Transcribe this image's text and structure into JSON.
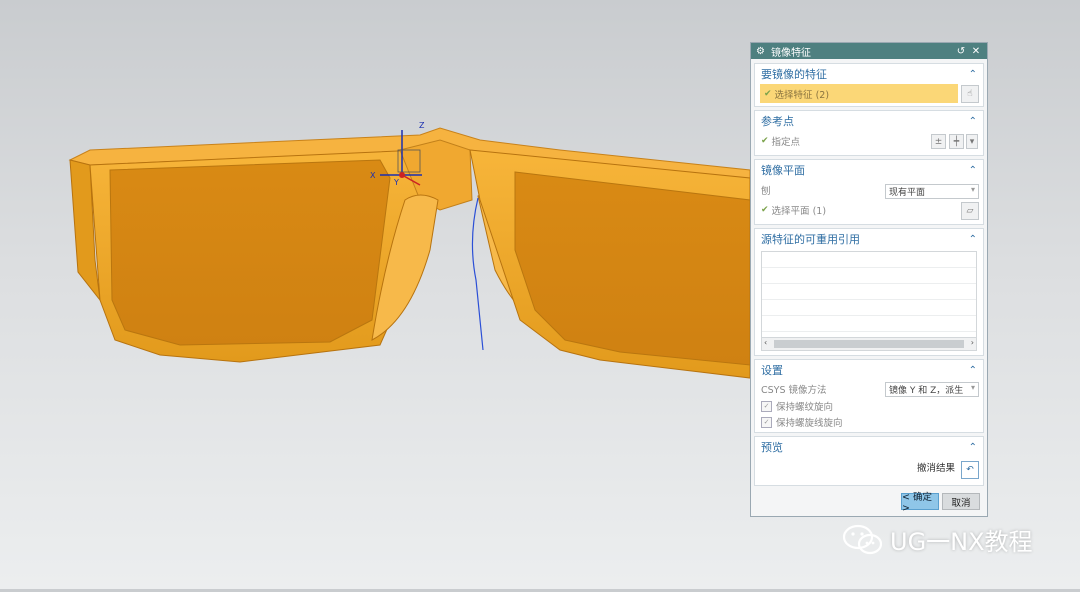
{
  "dialog": {
    "title": "镜像特征",
    "reset_icon": "reset-icon",
    "close_icon": "close-icon",
    "sec_features": {
      "title": "要镜像的特征",
      "select_label": "选择特征 (2)"
    },
    "sec_ref_point": {
      "title": "参考点",
      "specify_label": "指定点"
    },
    "sec_plane": {
      "title": "镜像平面",
      "plane_label": "刨",
      "plane_value": "现有平面",
      "select_label": "选择平面 (1)"
    },
    "sec_reuse": {
      "title": "源特征的可重用引用"
    },
    "sec_settings": {
      "title": "设置",
      "csys_label": "CSYS 镜像方法",
      "csys_value": "镜像 Y 和 Z，派生",
      "cb1_label": "保持螺纹旋向",
      "cb2_label": "保持螺旋线旋向"
    },
    "sec_preview": {
      "title": "预览",
      "undo_label": "撤消结果"
    },
    "ok_label": "< 确定 >",
    "cancel_label": "取消"
  },
  "watermark": {
    "text": "UG一NX教程",
    "icon": "wechat-icon"
  },
  "viewport": {
    "axis_x": "X",
    "axis_y": "Y",
    "axis_z": "Z",
    "model_color": "#f0a020"
  }
}
